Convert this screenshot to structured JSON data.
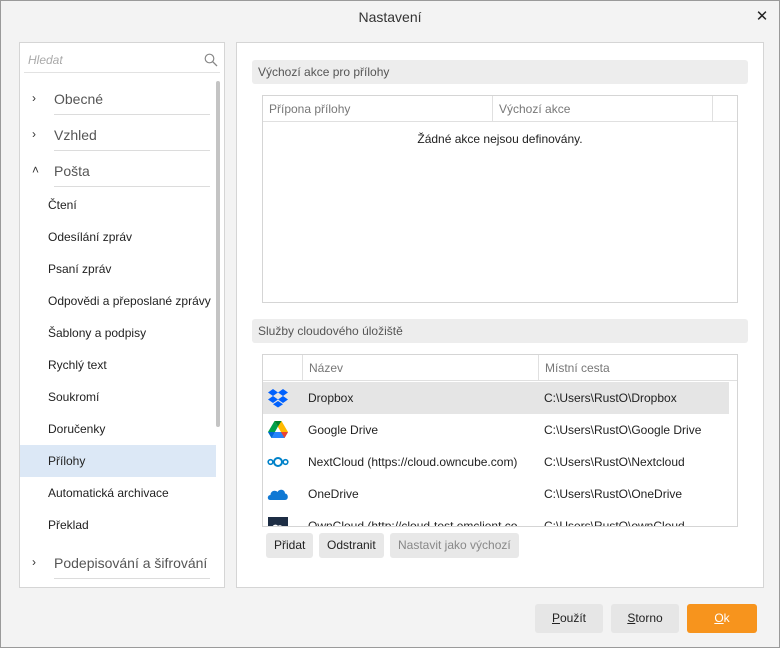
{
  "window": {
    "title": "Nastavení",
    "close_glyph": "✕"
  },
  "search": {
    "placeholder": "Hledat"
  },
  "nav": {
    "categories": [
      {
        "label": "Obecné",
        "chevron": "›"
      },
      {
        "label": "Vzhled",
        "chevron": "›"
      },
      {
        "label": "Pošta",
        "chevron": "˄"
      },
      {
        "label": "Podepisování a šifrování",
        "chevron": "›"
      }
    ],
    "mail_items": [
      "Čtení",
      "Odesílání zpráv",
      "Psaní zpráv",
      "Odpovědi a přeposlané zprávy",
      "Šablony a podpisy",
      "Rychlý text",
      "Soukromí",
      "Doručenky",
      "Přílohy",
      "Automatická archivace",
      "Překlad"
    ],
    "selected": "Přílohy"
  },
  "attachments": {
    "section_title": "Výchozí akce pro přílohy",
    "col_extension": "Přípona přílohy",
    "col_action": "Výchozí akce",
    "empty_message": "Žádné akce nejsou definovány."
  },
  "cloud": {
    "section_title": "Služby cloudového úložiště",
    "col_name": "Název",
    "col_path": "Místní cesta",
    "rows": [
      {
        "name": "Dropbox",
        "path": "C:\\Users\\RustO\\Dropbox",
        "icon": "dropbox-icon"
      },
      {
        "name": "Google Drive",
        "path": "C:\\Users\\RustO\\Google Drive",
        "icon": "google-drive-icon"
      },
      {
        "name": "NextCloud (https://cloud.owncube.com)",
        "path": "C:\\Users\\RustO\\Nextcloud",
        "icon": "nextcloud-icon"
      },
      {
        "name": "OneDrive",
        "path": "C:\\Users\\RustO\\OneDrive",
        "icon": "onedrive-icon"
      },
      {
        "name": "OwnCloud (http://cloud-test.emclient.co",
        "path": "C:\\Users\\RustO\\ownCloud",
        "icon": "owncloud-icon"
      }
    ],
    "add_label": "Přidat",
    "remove_label": "Odstranit",
    "default_label": "Nastavit jako výchozí"
  },
  "buttons": {
    "apply_u": "P",
    "apply_rest": "oužít",
    "cancel_u": "S",
    "cancel_rest": "torno",
    "ok_u": "O",
    "ok_rest": "k"
  },
  "colors": {
    "accent": "#f7941d",
    "selection": "#dce8f6"
  }
}
